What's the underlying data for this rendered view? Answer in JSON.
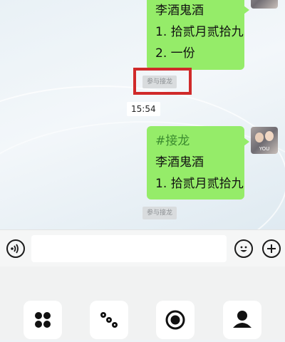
{
  "chat": {
    "message1": {
      "name": "李酒鬼酒",
      "items": [
        "1. 拾贰月贰拾九",
        "2. 一份"
      ],
      "join_label": "参与接龙"
    },
    "timestamp": "15:54",
    "message2": {
      "tag": "#接龙",
      "name": "李酒鬼酒",
      "items": [
        "1. 拾贰月贰拾九"
      ],
      "join_label": "参与接龙"
    },
    "avatar_caption": "YOU"
  },
  "input": {
    "placeholder": ""
  },
  "panel": {
    "tiles": [
      "apps-icon",
      "dice-icon",
      "record-icon",
      "contact-icon"
    ]
  },
  "colors": {
    "bubble": "#95ec69",
    "highlight": "#d02a2a",
    "tag": "#3b8b2f"
  }
}
